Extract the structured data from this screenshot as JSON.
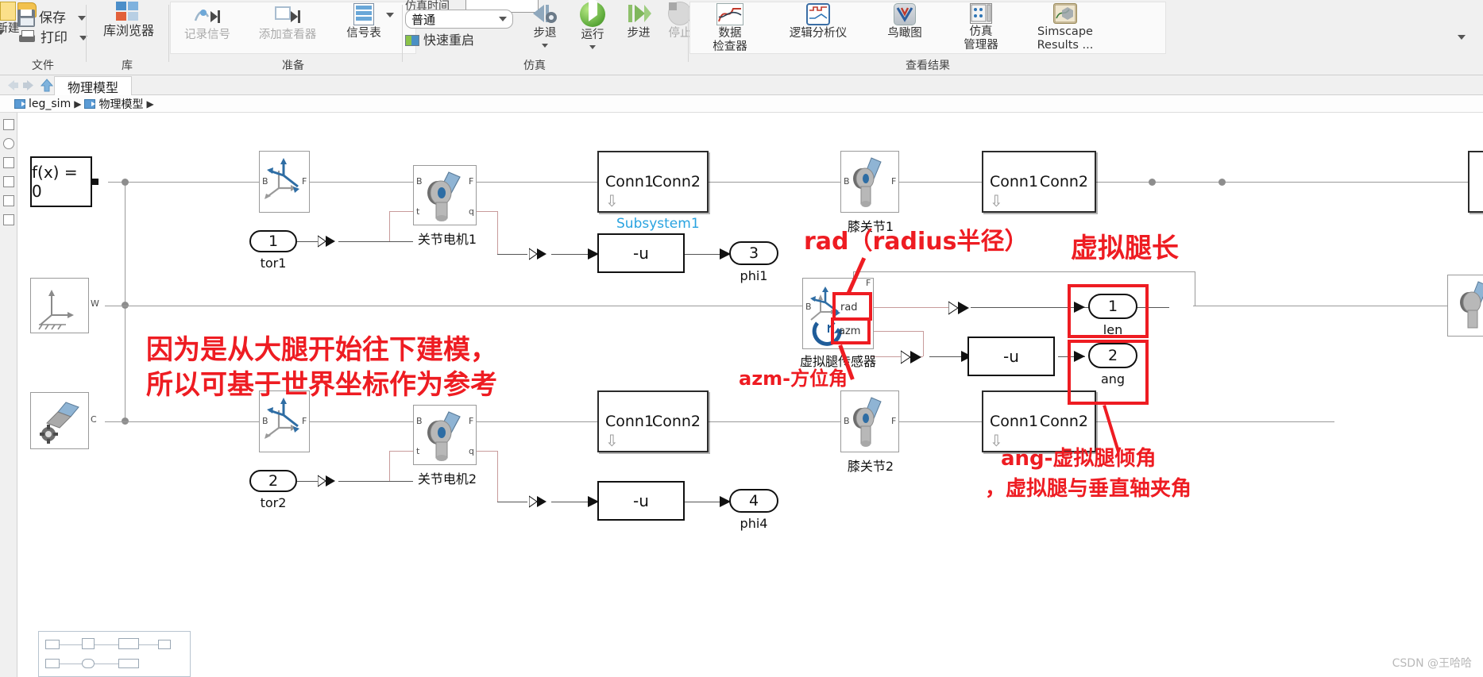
{
  "ribbon": {
    "groups": [
      {
        "name": "file",
        "caption": "文件"
      },
      {
        "name": "library",
        "caption": "库"
      },
      {
        "name": "prepare",
        "caption": "准备"
      },
      {
        "name": "simulate",
        "caption": "仿真"
      },
      {
        "name": "results",
        "caption": "查看结果"
      }
    ],
    "file": {
      "new_label": "新建",
      "save_label": "保存",
      "print_label": "打印"
    },
    "library": {
      "browser_label": "库浏览器",
      "icon": "library-grid-icon"
    },
    "prepare": {
      "log_signals_label": "记录信号",
      "add_viewer_label": "添加查看器",
      "signal_table_label": "信号表"
    },
    "simulate": {
      "stop_time_label": "仿真时间",
      "stop_time_value": "",
      "mode_value": "普通",
      "fast_restart_label": "快速重启",
      "step_back_label": "步退",
      "run_label": "运行",
      "step_forward_label": "步进",
      "stop_label": "停止"
    },
    "results": {
      "data_inspector_line1": "数据",
      "data_inspector_line2": "检查器",
      "logic_analyzer_label": "逻辑分析仪",
      "birdseye_label": "鸟瞰图",
      "sim_manager_line1": "仿真",
      "sim_manager_line2": "管理器",
      "simscape_line1": "Simscape",
      "simscape_line2": "Results ..."
    }
  },
  "tabs": {
    "back_icon": "back-arrow-icon",
    "forward_icon": "forward-arrow-icon",
    "up_icon": "up-arrow-icon",
    "active_tab": "物理模型",
    "overflow_icon": "chevron-down-icon"
  },
  "breadcrumb": {
    "items": [
      "leg_sim",
      "物理模型"
    ],
    "separator": "▶"
  },
  "canvas": {
    "solver_block": "f(x) = 0",
    "subsystem_link": "Subsystem1",
    "transform_port_b": "B",
    "transform_port_f": "F",
    "world_port_w": "W",
    "body_port_c": "C",
    "gain_expr": "-u",
    "conn1": "Conn1",
    "conn2": "Conn2",
    "sensor_port_rad": "rad",
    "sensor_port_azm": "azm",
    "blocks": {
      "motor1_label": "关节电机1",
      "motor2_label": "关节电机2",
      "knee1_label": "膝关节1",
      "knee2_label": "膝关节2",
      "virtual_leg_sensor_label": "虚拟腿传感器"
    },
    "ports": {
      "tor1_num": "1",
      "tor1_name": "tor1",
      "tor2_num": "2",
      "tor2_name": "tor2",
      "phi1_num": "3",
      "phi1_name": "phi1",
      "phi4_num": "4",
      "phi4_name": "phi4",
      "len_num": "1",
      "len_name": "len",
      "ang_num": "2",
      "ang_name": "ang"
    }
  },
  "annotations": {
    "model_note_line1": "因为是从大腿开始往下建模，",
    "model_note_line2": "所以可基于世界坐标作为参考",
    "rad_note": "rad（radius半径）",
    "azm_note": "azm-方位角",
    "leg_len_note": "虚拟腿长",
    "ang_note_line1": "ang-虚拟腿倾角",
    "ang_note_line2": "，虚拟腿与垂直轴夹角",
    "color": "#ee1c22"
  },
  "watermark": "CSDN @王哈哈"
}
